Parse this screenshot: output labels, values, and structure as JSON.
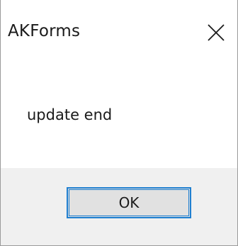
{
  "dialog": {
    "title": "AKForms",
    "close_icon": "close-icon",
    "message": "update end",
    "ok_label": "OK"
  },
  "colors": {
    "footer_background": "#f0f0f0",
    "button_background": "#e1e1e1",
    "button_focus_border": "#1f7fd0",
    "text": "#1a1a1a"
  }
}
